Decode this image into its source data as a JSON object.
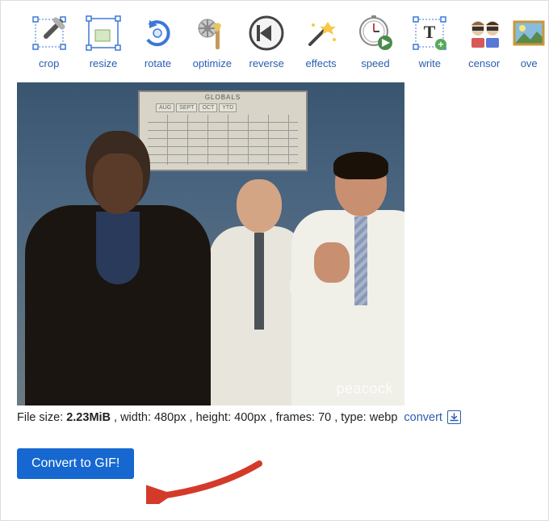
{
  "toolbar": {
    "items": [
      {
        "name": "crop",
        "label": "crop"
      },
      {
        "name": "resize",
        "label": "resize"
      },
      {
        "name": "rotate",
        "label": "rotate"
      },
      {
        "name": "optimize",
        "label": "optimize"
      },
      {
        "name": "reverse",
        "label": "reverse"
      },
      {
        "name": "effects",
        "label": "effects"
      },
      {
        "name": "speed",
        "label": "speed"
      },
      {
        "name": "write",
        "label": "write"
      },
      {
        "name": "censor",
        "label": "censor"
      },
      {
        "name": "overlay",
        "label": "ove"
      }
    ]
  },
  "preview": {
    "board_header": "GLOBALS",
    "board_months": [
      "AUG",
      "SEPT",
      "OCT",
      "YTD"
    ],
    "watermark": "peacock"
  },
  "file_info": {
    "prefix": "File size:",
    "size": "2.23MiB",
    "width_label": ", width: 480px",
    "height_label": ", height: 400px",
    "frames_label": ", frames: 70",
    "type_label": ", type: webp",
    "convert_link": "convert"
  },
  "actions": {
    "convert_button": "Convert to GIF!"
  }
}
